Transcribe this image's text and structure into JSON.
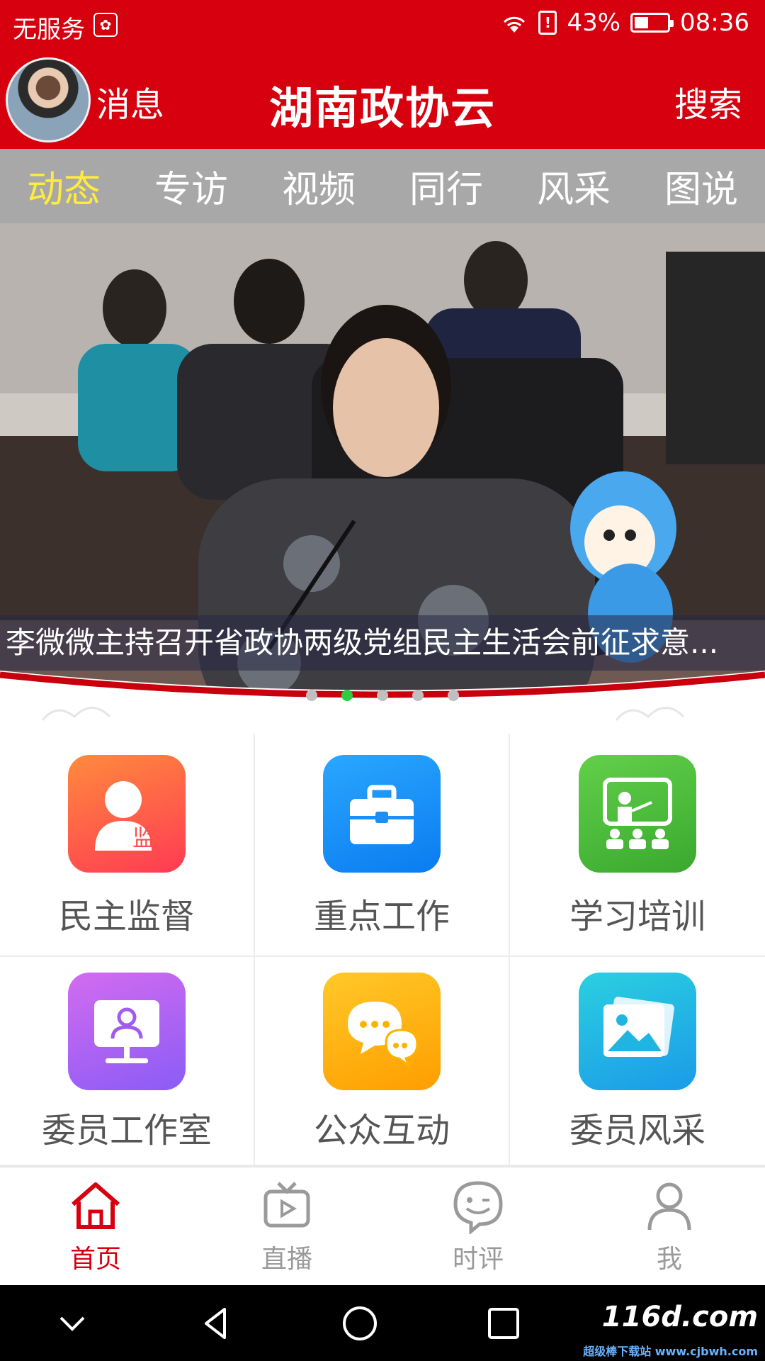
{
  "status_bar": {
    "carrier": "无服务",
    "battery_percent": "43%",
    "battery_level": 0.43,
    "time": "08:36"
  },
  "header": {
    "messages_label": "消息",
    "title": "湖南政协云",
    "search_label": "搜索"
  },
  "tabs": [
    {
      "label": "动态",
      "active": true
    },
    {
      "label": "专访"
    },
    {
      "label": "视频"
    },
    {
      "label": "同行"
    },
    {
      "label": "风采"
    },
    {
      "label": "图说"
    }
  ],
  "banner": {
    "caption": "李微微主持召开省政协两级党组民主生活会前征求意...",
    "slide_count": 5,
    "active_slide": 2
  },
  "features": [
    {
      "label": "民主监督",
      "icon": "supervision-person-icon",
      "color": "#ff5a4e",
      "badge": "监"
    },
    {
      "label": "重点工作",
      "icon": "briefcase-icon",
      "color": "#1b8ff5"
    },
    {
      "label": "学习培训",
      "icon": "classroom-icon",
      "color": "#4cbb3a"
    },
    {
      "label": "委员工作室",
      "icon": "monitor-person-icon",
      "color": "#a05cf0"
    },
    {
      "label": "公众互动",
      "icon": "chat-bubbles-icon",
      "color": "#ffb300"
    },
    {
      "label": "委员风采",
      "icon": "gallery-icon",
      "color": "#1fb5e0"
    }
  ],
  "bottom_nav": [
    {
      "label": "首页",
      "icon": "home-icon",
      "active": true
    },
    {
      "label": "直播",
      "icon": "tv-icon"
    },
    {
      "label": "时评",
      "icon": "wink-chat-icon"
    },
    {
      "label": "我",
      "icon": "user-icon"
    }
  ],
  "colors": {
    "brand_red": "#d7000f",
    "tab_bar_gray": "#a8a8a8",
    "active_tab": "#ffeb3b",
    "active_dot": "#2ecc40"
  },
  "watermark": {
    "text": "116d.com",
    "sub": "超级棒下载站 www.cjbwh.com"
  }
}
